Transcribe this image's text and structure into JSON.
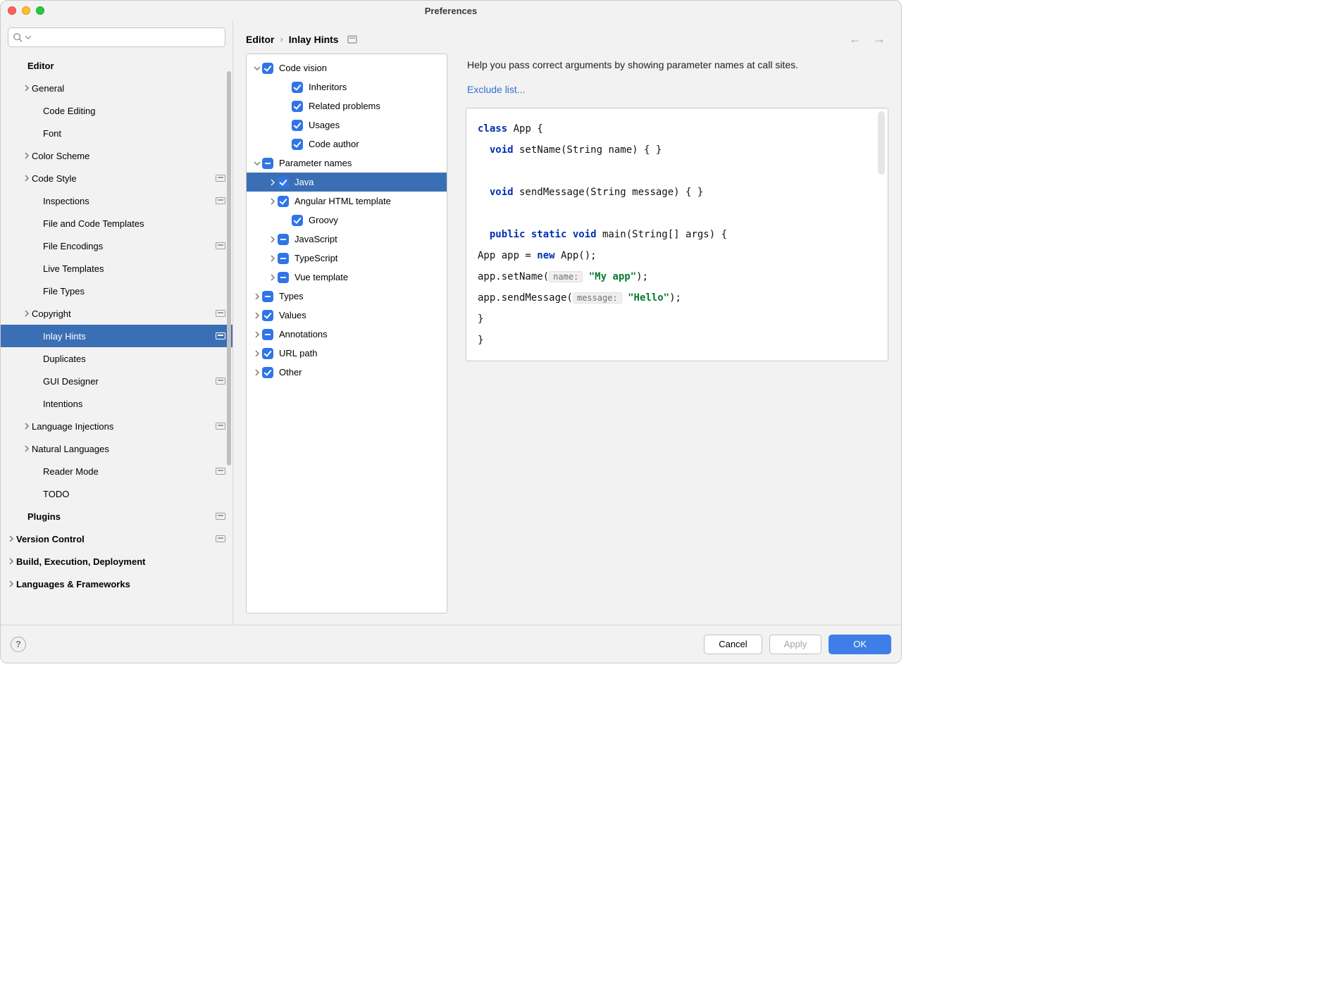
{
  "window": {
    "title": "Preferences"
  },
  "search": {
    "placeholder": ""
  },
  "sidebar": {
    "items": [
      {
        "label": "Editor",
        "indent": 38,
        "bold": true,
        "arrow": ""
      },
      {
        "label": "General",
        "indent": 44,
        "arrow": "right"
      },
      {
        "label": "Code Editing",
        "indent": 60
      },
      {
        "label": "Font",
        "indent": 60
      },
      {
        "label": "Color Scheme",
        "indent": 44,
        "arrow": "right"
      },
      {
        "label": "Code Style",
        "indent": 44,
        "arrow": "right",
        "badge": true
      },
      {
        "label": "Inspections",
        "indent": 60,
        "badge": true
      },
      {
        "label": "File and Code Templates",
        "indent": 60
      },
      {
        "label": "File Encodings",
        "indent": 60,
        "badge": true
      },
      {
        "label": "Live Templates",
        "indent": 60
      },
      {
        "label": "File Types",
        "indent": 60
      },
      {
        "label": "Copyright",
        "indent": 44,
        "arrow": "right",
        "badge": true
      },
      {
        "label": "Inlay Hints",
        "indent": 60,
        "badge": true,
        "selected": true
      },
      {
        "label": "Duplicates",
        "indent": 60
      },
      {
        "label": "GUI Designer",
        "indent": 60,
        "badge": true
      },
      {
        "label": "Intentions",
        "indent": 60
      },
      {
        "label": "Language Injections",
        "indent": 44,
        "arrow": "right",
        "badge": true
      },
      {
        "label": "Natural Languages",
        "indent": 44,
        "arrow": "right"
      },
      {
        "label": "Reader Mode",
        "indent": 60,
        "badge": true
      },
      {
        "label": "TODO",
        "indent": 60
      },
      {
        "label": "Plugins",
        "indent": 38,
        "bold": true,
        "badge": true
      },
      {
        "label": "Version Control",
        "indent": 22,
        "bold": true,
        "arrow": "right",
        "badge": true
      },
      {
        "label": "Build, Execution, Deployment",
        "indent": 22,
        "bold": true,
        "arrow": "right"
      },
      {
        "label": "Languages & Frameworks",
        "indent": 22,
        "bold": true,
        "arrow": "right"
      }
    ]
  },
  "breadcrumb": {
    "a": "Editor",
    "b": "Inlay Hints"
  },
  "midtree": [
    {
      "label": "Code vision",
      "indent": 8,
      "arrow": "down",
      "state": "checked"
    },
    {
      "label": "Inheritors",
      "indent": 50,
      "state": "checked"
    },
    {
      "label": "Related problems",
      "indent": 50,
      "state": "checked"
    },
    {
      "label": "Usages",
      "indent": 50,
      "state": "checked"
    },
    {
      "label": "Code author",
      "indent": 50,
      "state": "checked"
    },
    {
      "label": "Parameter names",
      "indent": 8,
      "arrow": "down",
      "state": "mixed"
    },
    {
      "label": "Java",
      "indent": 30,
      "arrow": "right",
      "state": "checked",
      "selected": true
    },
    {
      "label": "Angular HTML template",
      "indent": 30,
      "arrow": "right",
      "state": "checked"
    },
    {
      "label": "Groovy",
      "indent": 50,
      "state": "checked"
    },
    {
      "label": "JavaScript",
      "indent": 30,
      "arrow": "right",
      "state": "mixed"
    },
    {
      "label": "TypeScript",
      "indent": 30,
      "arrow": "right",
      "state": "mixed"
    },
    {
      "label": "Vue template",
      "indent": 30,
      "arrow": "right",
      "state": "mixed"
    },
    {
      "label": "Types",
      "indent": 8,
      "arrow": "right",
      "state": "mixed"
    },
    {
      "label": "Values",
      "indent": 8,
      "arrow": "right",
      "state": "checked"
    },
    {
      "label": "Annotations",
      "indent": 8,
      "arrow": "right",
      "state": "mixed"
    },
    {
      "label": "URL path",
      "indent": 8,
      "arrow": "right",
      "state": "checked"
    },
    {
      "label": "Other",
      "indent": 8,
      "arrow": "right",
      "state": "checked"
    }
  ],
  "detail": {
    "description": "Help you pass correct arguments by showing parameter names at call sites.",
    "link": "Exclude list..."
  },
  "code": {
    "l1a": "class",
    "l1b": " App {",
    "l2a": "void",
    "l2b": " setName(String name) { }",
    "l3a": "void",
    "l3b": " sendMessage(String message) { }",
    "l4a": "public static void",
    "l4b": " main(String[] args) {",
    "l5a": "    App app = ",
    "l5b": "new",
    "l5c": " App();",
    "l6a": "    app.setName(",
    "l6hint": "name:",
    "l6b": " ",
    "l6str": "\"My app\"",
    "l6c": ");",
    "l7a": "    app.sendMessage(",
    "l7hint": "message:",
    "l7b": " ",
    "l7str": "\"Hello\"",
    "l7c": ");",
    "l8": "  }",
    "l9": "}"
  },
  "footer": {
    "cancel": "Cancel",
    "apply": "Apply",
    "ok": "OK"
  }
}
